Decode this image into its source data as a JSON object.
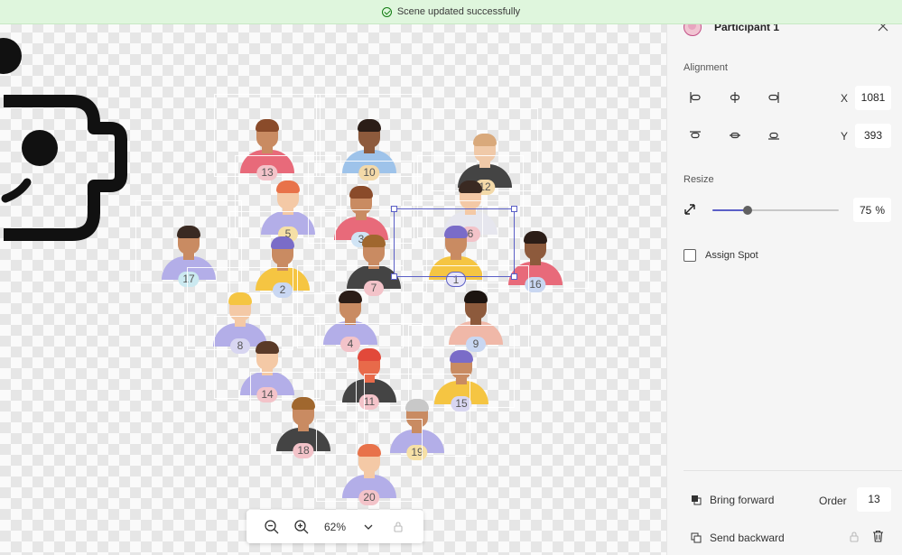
{
  "toast": {
    "message": "Scene updated successfully"
  },
  "panel": {
    "title": "Participant  1",
    "alignment_label": "Alignment",
    "x_label": "X",
    "x_value": "1081",
    "y_label": "Y",
    "y_value": "393",
    "resize_label": "Resize",
    "resize_value": "75",
    "resize_unit": "%",
    "resize_fraction": 0.28,
    "assign_spot_label": "Assign Spot",
    "assign_spot_checked": false,
    "bring_forward_label": "Bring forward",
    "send_backward_label": "Send backward",
    "order_label": "Order",
    "order_value": "13"
  },
  "zoom": {
    "value": "62%"
  },
  "participants": [
    {
      "n": "13",
      "shirt": "#e86a7a",
      "skin": "#c98b62",
      "hair": "#8a4b2a",
      "badge": "#f3c3c9"
    },
    {
      "n": "10",
      "shirt": "#9ec3ea",
      "skin": "#8d5a3c",
      "hair": "#2b1d17",
      "badge": "#f3d9a8"
    },
    {
      "n": "12",
      "shirt": "#444444",
      "skin": "#f0c9a8",
      "hair": "#d9a97b",
      "badge": "#f3d9a8"
    },
    {
      "n": "5",
      "shirt": "#b3aee8",
      "skin": "#f4c9a6",
      "hair": "#e8724a",
      "badge": "#f6e0a6"
    },
    {
      "n": "3",
      "shirt": "#e86a7a",
      "skin": "#c98b62",
      "hair": "#8a4b2a",
      "badge": "#d0e4f5"
    },
    {
      "n": "6",
      "shirt": "#e6e6ee",
      "skin": "#f4c9a6",
      "hair": "#3a2a22",
      "badge": "#f3c3c9"
    },
    {
      "n": "17",
      "shirt": "#b3aee8",
      "skin": "#c98b62",
      "hair": "#3a2a22",
      "badge": "#cbe9f0"
    },
    {
      "n": "2",
      "shirt": "#f5c542",
      "skin": "#c98b62",
      "hair": "#7a6cc8",
      "badge": "#c9d7f2"
    },
    {
      "n": "7",
      "shirt": "#444444",
      "skin": "#c98b62",
      "hair": "#a0672e",
      "badge": "#f3c3c9"
    },
    {
      "n": "1",
      "shirt": "#f5c542",
      "skin": "#c98b62",
      "hair": "#7a6cc8",
      "badge": "#d8d6f1"
    },
    {
      "n": "16",
      "shirt": "#e86a7a",
      "skin": "#8d5a3c",
      "hair": "#2b1d17",
      "badge": "#c9d7f2"
    },
    {
      "n": "8",
      "shirt": "#b3aee8",
      "skin": "#f4c9a6",
      "hair": "#f5c542",
      "badge": "#d8d6f1"
    },
    {
      "n": "4",
      "shirt": "#b3aee8",
      "skin": "#c98b62",
      "hair": "#2b1d17",
      "badge": "#f3c3c9"
    },
    {
      "n": "9",
      "shirt": "#f0b8a8",
      "skin": "#8d5a3c",
      "hair": "#1c1410",
      "badge": "#c9d7f2"
    },
    {
      "n": "14",
      "shirt": "#b3aee8",
      "skin": "#f4c9a6",
      "hair": "#5a3a28",
      "badge": "#f3c3c9"
    },
    {
      "n": "11",
      "shirt": "#444444",
      "skin": "#e86a4a",
      "hair": "#e2493a",
      "badge": "#f3c3c9"
    },
    {
      "n": "15",
      "shirt": "#f5c542",
      "skin": "#c98b62",
      "hair": "#7a6cc8",
      "badge": "#d8d6f1"
    },
    {
      "n": "18",
      "shirt": "#444444",
      "skin": "#c98b62",
      "hair": "#a0672e",
      "badge": "#f3c3c9"
    },
    {
      "n": "19",
      "shirt": "#b3aee8",
      "skin": "#c98b62",
      "hair": "#c8c8c8",
      "badge": "#f6e0a6"
    },
    {
      "n": "20",
      "shirt": "#b3aee8",
      "skin": "#f4c9a6",
      "hair": "#e8724a",
      "badge": "#f3c3c9"
    }
  ]
}
